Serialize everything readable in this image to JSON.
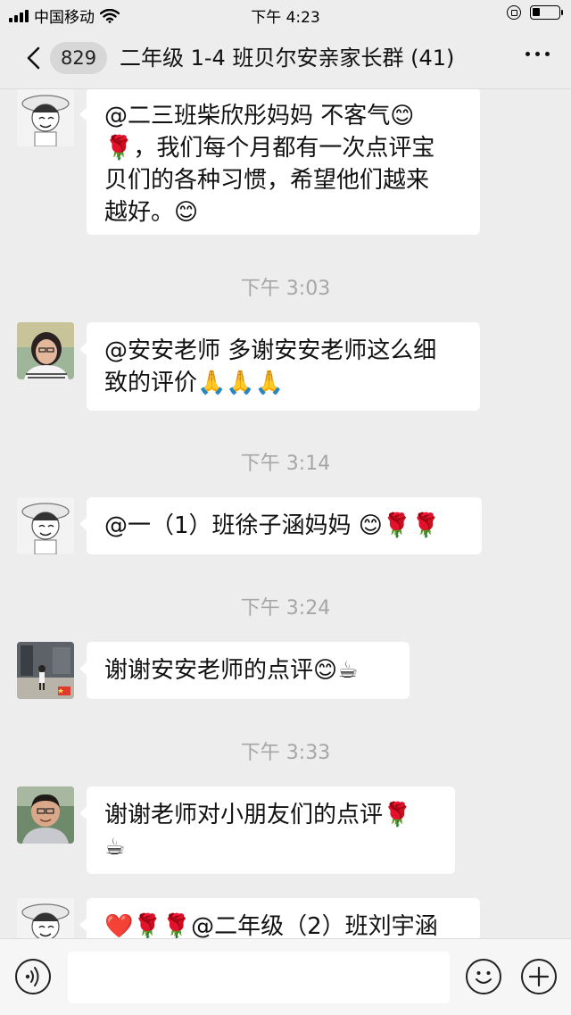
{
  "status_bar": {
    "carrier": "中国移动",
    "time": "下午 4:23"
  },
  "nav": {
    "unread_count": "829",
    "title": "二年级 1-4 班贝尔安亲家长群 (41)"
  },
  "messages": [
    {
      "text_lines": [
        "@二三班柴欣彤妈妈 不客气😊",
        "🌹，我们每个月都有一次点评宝",
        "贝们的各种习惯，希望他们越来",
        "越好。😊"
      ],
      "avatar": "cartoon-avatar"
    },
    {
      "timestamp": "下午 3:03"
    },
    {
      "text_lines": [
        "@安安老师 多谢安安老师这么细",
        "致的评价🙏🙏🙏"
      ],
      "avatar": "woman-avatar"
    },
    {
      "timestamp": "下午 3:14"
    },
    {
      "text_lines": [
        "@一（1）班徐子涵妈妈 😊🌹🌹"
      ],
      "avatar": "cartoon-avatar"
    },
    {
      "timestamp": "下午 3:24"
    },
    {
      "text_lines": [
        "谢谢安安老师的点评😊☕"
      ],
      "avatar": "child-photo-avatar"
    },
    {
      "timestamp": "下午 3:33"
    },
    {
      "text_lines": [
        "谢谢老师对小朋友们的点评🌹",
        "☕"
      ],
      "avatar": "man-avatar"
    },
    {
      "text_lines": [
        "❤️🌹🌹@二年级（2）班刘宇涵"
      ],
      "avatar": "cartoon-avatar"
    }
  ],
  "icons": {
    "back": "chevron-left-icon",
    "more": "more-dots-icon",
    "voice": "voice-icon",
    "emoji": "emoji-icon",
    "plus": "plus-icon"
  }
}
